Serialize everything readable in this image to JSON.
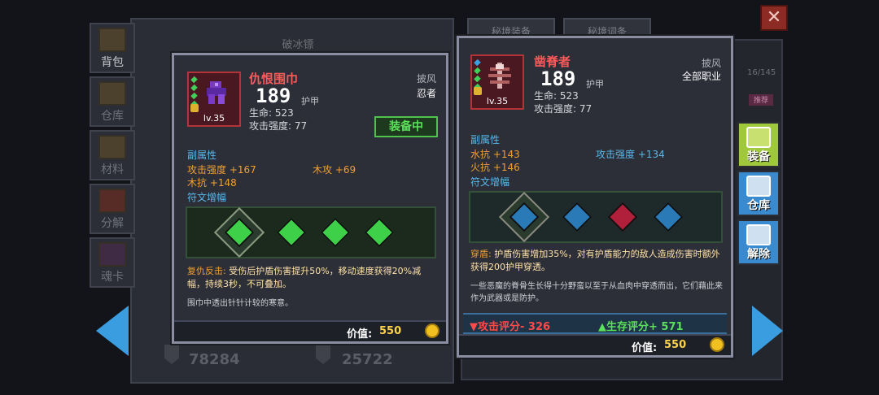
{
  "background": {
    "frame_title": "破冰镖",
    "tab_1": "秘境装备",
    "tab_2": "秘境词条",
    "count": "16/145",
    "tag": "推荐",
    "stat_left": "78284",
    "stat_right": "25722"
  },
  "nav": {
    "items": [
      {
        "label": "背包",
        "icon": "backpack-icon"
      },
      {
        "label": "仓库",
        "icon": "warehouse-icon"
      },
      {
        "label": "材料",
        "icon": "materials-icon"
      },
      {
        "label": "分解",
        "icon": "decompose-icon"
      },
      {
        "label": "魂卡",
        "icon": "soul-card-icon"
      }
    ]
  },
  "side_buttons": {
    "equip": "装备",
    "warehouse": "仓库",
    "unlock": "解除"
  },
  "left_card": {
    "name": "仇恨围巾",
    "level": "lv.35",
    "armor": "189",
    "armor_label": "护甲",
    "hp": "生命: 523",
    "atk": "攻击强度: 77",
    "slot": "披风",
    "class": "忍者",
    "equipped": "装备中",
    "sub_title": "副属性",
    "attrs": [
      "攻击强度 +167",
      "木攻 +69",
      "木抗 +148"
    ],
    "rune_title": "符文增幅",
    "effect_name": "复仇反击:",
    "effect_text": " 受伤后护盾伤害提升50%，移动速度获得20%减幅，持续3秒，不可叠加。",
    "flavor": "围巾中透出针针计较的寒意。",
    "price_label": "价值:",
    "price": "550",
    "rank_color": "#3fd05a",
    "rune_color": "#3fd04a"
  },
  "right_card": {
    "name": "凿脊者",
    "level": "lv.35",
    "armor": "189",
    "armor_label": "护甲",
    "hp": "生命: 523",
    "atk": "攻击强度: 77",
    "slot": "披风",
    "class": "全部职业",
    "sub_title": "副属性",
    "attrs": [
      "水抗 +143",
      "攻击强度 +134",
      "火抗 +146"
    ],
    "rune_title": "符文增幅",
    "effect_name": "穿盾:",
    "effect_text": " 护盾伤害增加35%，对有护盾能力的敌人造成伤害时额外获得200护甲穿透。",
    "flavor": "一些恶魔的脊骨生长得十分野蛮以至于从血肉中穿透而出，它们藉此来作为武器或是防护。",
    "compare_atk": "▼攻击评分- 326",
    "compare_sur": "▲生存评分+ 571",
    "price_label": "价值:",
    "price": "550",
    "rank_color": "#3aa0e0",
    "rune_blue": "#2b7ab8",
    "rune_red": "#b0203a"
  }
}
